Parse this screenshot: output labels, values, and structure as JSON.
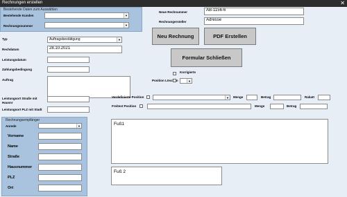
{
  "window": {
    "title": "Rechnungen erstellen",
    "close_glyph": "✕"
  },
  "lookup": {
    "title": "Bestehende Daten zum Auswählen",
    "customer_label": "Bestehende Kunden",
    "customer_value": "",
    "invoice_label": "Rechnungsnummer",
    "invoice_value": ""
  },
  "header_fields": {
    "new_number_label": "Neue Rechnummer",
    "new_number_value": "AB-1156-6",
    "creator_label": "Rechnungersteller",
    "creator_value": "Adresse"
  },
  "buttons": {
    "new_invoice": "Neu Rechnung",
    "pdf_create": "PDF Erstellen",
    "close_form": "Formular Schließen"
  },
  "form": {
    "type_label": "Typ",
    "type_value": "Auftragsbestätigung",
    "date_label": "Rechdatum",
    "date_value": "28.10.2021",
    "service_date_label": "Leistungsdatum",
    "service_date_value": "",
    "payment_label": "Zahlungsbedingung",
    "payment_value": "",
    "order_label": "Auftrag",
    "order_value": "",
    "street_label": "Leistungsort Straße mit Hausnr",
    "street_value": "",
    "plz_city_label": "Leistungsort PLZ mit Stadt",
    "plz_city_value": ""
  },
  "positions": {
    "corrected_label": "Korrigierte",
    "delete_label": "Position Löschen",
    "predefined_label": "Vordefinierte Position",
    "free_label": "Freitext Position",
    "qty_label": "Menge",
    "amount_label": "Betrag",
    "discount_label": "Rabatt"
  },
  "recipient": {
    "title": "Rechnungsempfänger",
    "salutation_label": "Anrede",
    "first_name_label": "Vorname",
    "name_label": "Name",
    "street_label": "Straße",
    "house_label": "Hausnummer",
    "plz_label": "PLZ",
    "city_label": "Ort"
  },
  "footer": {
    "foot1": "Fuß1",
    "foot2": "Fuß 2"
  }
}
